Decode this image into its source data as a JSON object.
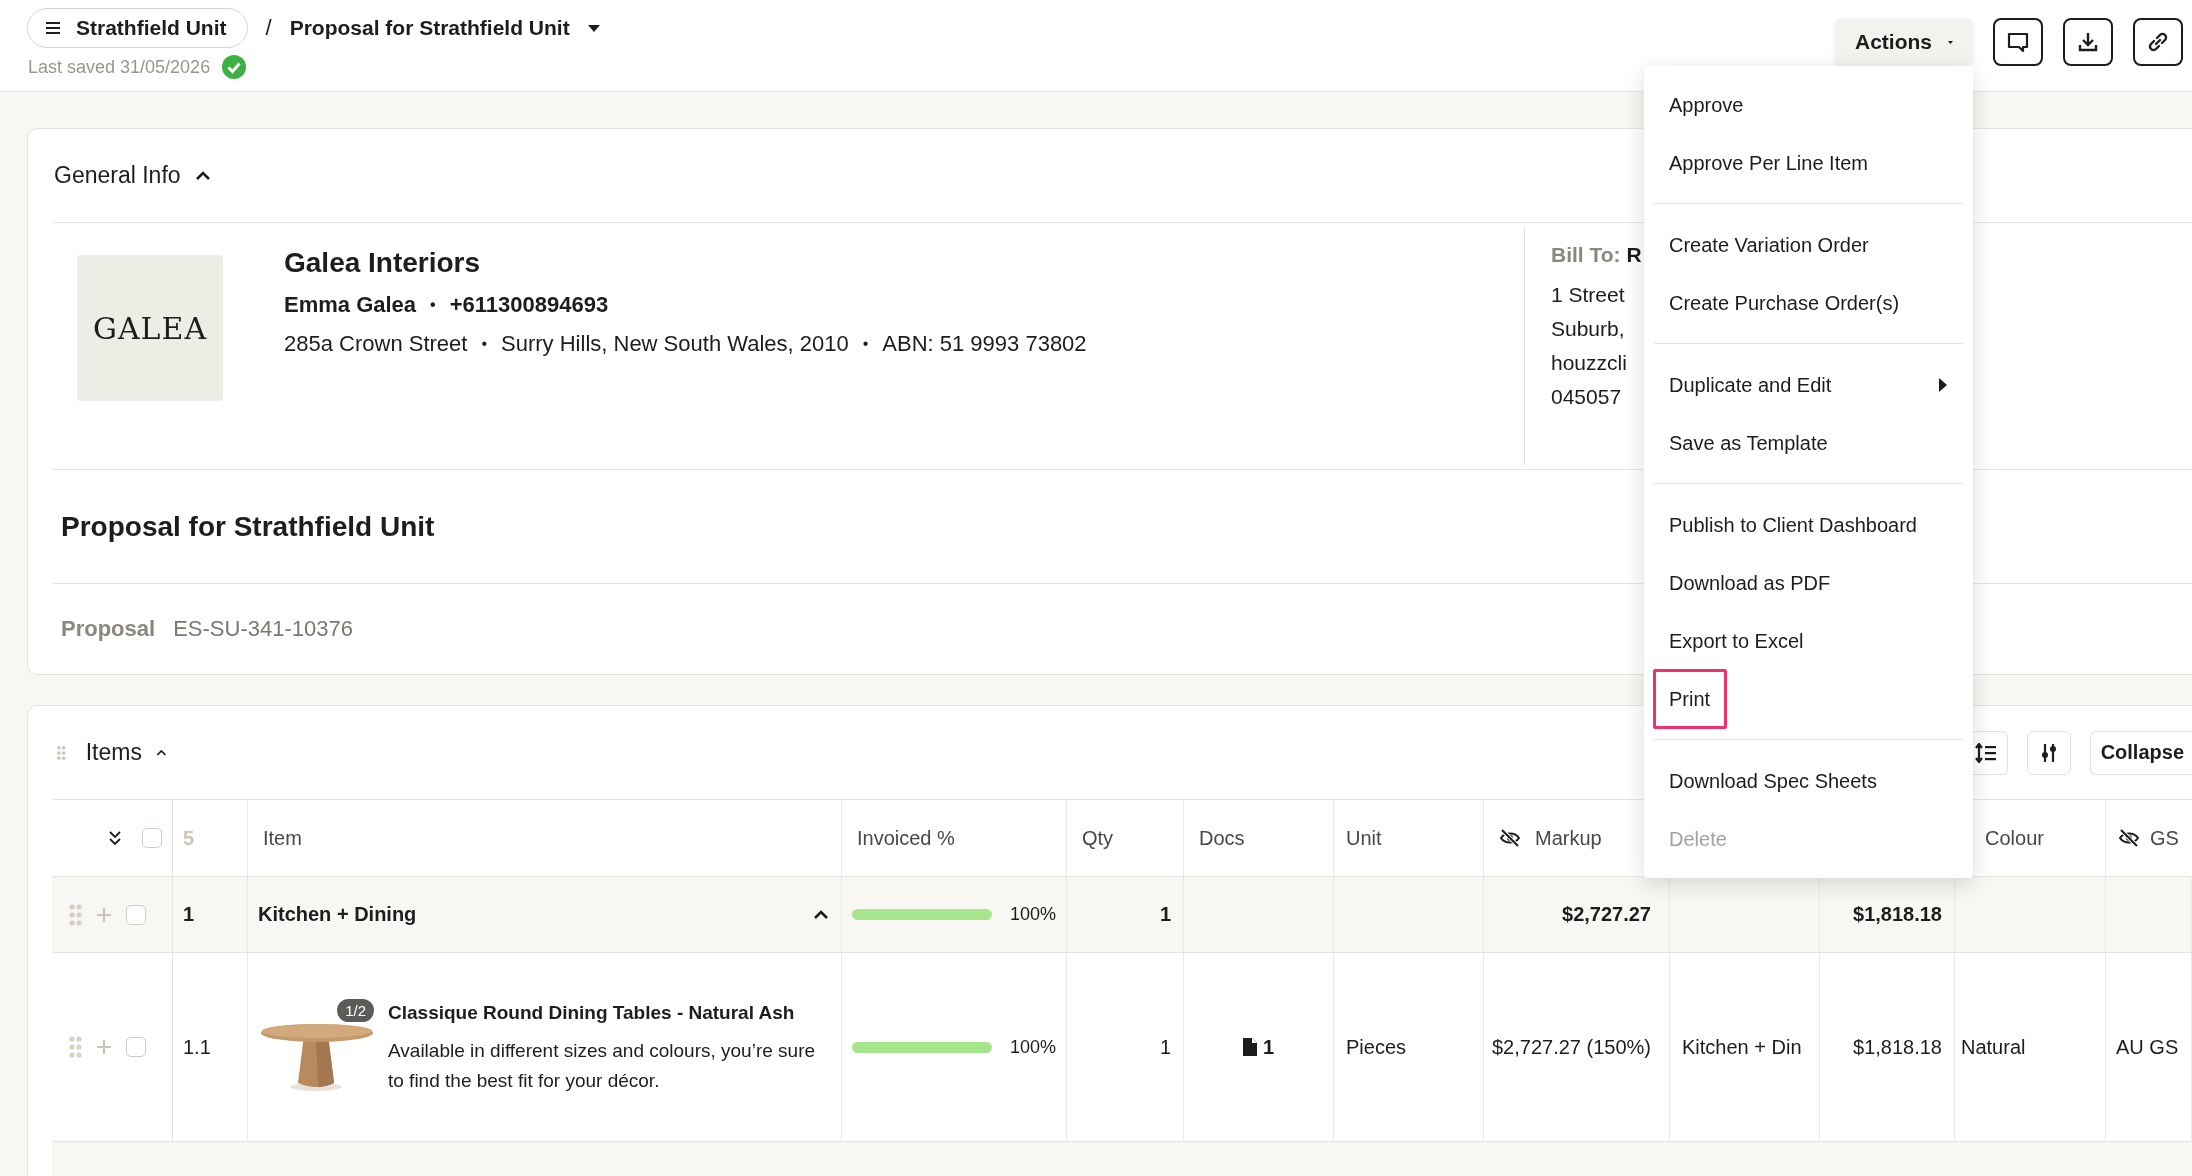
{
  "breadcrumb": {
    "project": "Strathfield Unit",
    "separator": "/",
    "document": "Proposal for Strathfield Unit"
  },
  "save_status": {
    "text": "Last saved 31/05/2026",
    "saved": true
  },
  "toolbar": {
    "actions_label": "Actions",
    "actions_open": true
  },
  "actions_menu": [
    [
      {
        "label": "Approve",
        "disabled": false,
        "submenu": false,
        "highlighted": false
      },
      {
        "label": "Approve Per Line Item",
        "disabled": false,
        "submenu": false,
        "highlighted": false
      }
    ],
    [
      {
        "label": "Create Variation Order",
        "disabled": false,
        "submenu": false,
        "highlighted": false
      },
      {
        "label": "Create Purchase Order(s)",
        "disabled": false,
        "submenu": false,
        "highlighted": false
      }
    ],
    [
      {
        "label": "Duplicate and Edit",
        "disabled": false,
        "submenu": true,
        "highlighted": false
      },
      {
        "label": "Save as Template",
        "disabled": false,
        "submenu": false,
        "highlighted": false
      }
    ],
    [
      {
        "label": "Publish to Client Dashboard",
        "disabled": false,
        "submenu": false,
        "highlighted": false
      },
      {
        "label": "Download as PDF",
        "disabled": false,
        "submenu": false,
        "highlighted": false
      },
      {
        "label": "Export to Excel",
        "disabled": false,
        "submenu": false,
        "highlighted": false
      },
      {
        "label": "Print",
        "disabled": false,
        "submenu": false,
        "highlighted": true
      }
    ],
    [
      {
        "label": "Download Spec Sheets",
        "disabled": false,
        "submenu": false,
        "highlighted": false
      },
      {
        "label": "Delete",
        "disabled": true,
        "submenu": false,
        "highlighted": false
      }
    ]
  ],
  "general_info": {
    "title": "General Info",
    "expanded": true,
    "company": {
      "logo_text": "GALEA",
      "name": "Galea Interiors",
      "contact": [
        "Emma Galea",
        "+611300894693"
      ],
      "address": [
        "285a Crown Street",
        "Surry Hills, New South Wales, 2010",
        "ABN: 51 9993 73802"
      ],
      "separator": "•"
    },
    "bill_to": {
      "label": "Bill To:",
      "name": "R",
      "lines": [
        "1 Street",
        "Suburb,",
        "houzzcli",
        "045057"
      ]
    },
    "proposal_title": "Proposal for Strathfield Unit",
    "proposal": {
      "label": "Proposal",
      "number": "ES-SU-341-10376"
    }
  },
  "items": {
    "title": "Items",
    "expanded": true,
    "collapse_label": "Collapse",
    "table": {
      "count": "5",
      "all_selected": false,
      "columns": [
        {
          "label": "Item",
          "visibility_off": false
        },
        {
          "label": "Invoiced %",
          "visibility_off": false
        },
        {
          "label": "Qty",
          "visibility_off": false
        },
        {
          "label": "Docs",
          "visibility_off": false
        },
        {
          "label": "Unit",
          "visibility_off": false
        },
        {
          "label": "Markup",
          "visibility_off": true
        },
        {},
        {},
        {
          "label": "Colour",
          "visibility_off": false
        },
        {
          "label": "GS",
          "visibility_off": true
        }
      ],
      "rows": [
        {
          "kind": "group",
          "number": "1",
          "name": "Kitchen + Dining",
          "expanded": true,
          "selected": false,
          "invoiced": {
            "level": 1,
            "reading": "100%"
          },
          "qty": "1",
          "markup": "$2,727.27",
          "price": "$1,818.18"
        },
        {
          "kind": "item",
          "number": "1.1",
          "selected": false,
          "image": {
            "kind": "picture",
            "counter": "1/2"
          },
          "name": "Classique Round Dining Tables - Natural Ash",
          "description": "Available in different sizes and colours, you’re sure to find the best fit for your décor.",
          "invoiced": {
            "level": 1,
            "reading": "100%"
          },
          "qty": "1",
          "docs": "1",
          "unit": "Pieces",
          "markup": "$2,727.27 (150%)",
          "room": "Kitchen + Din",
          "price": "$1,818.18",
          "colour": "Natural",
          "gst": "AU GS"
        },
        {
          "kind": "hidden_row"
        }
      ]
    }
  }
}
